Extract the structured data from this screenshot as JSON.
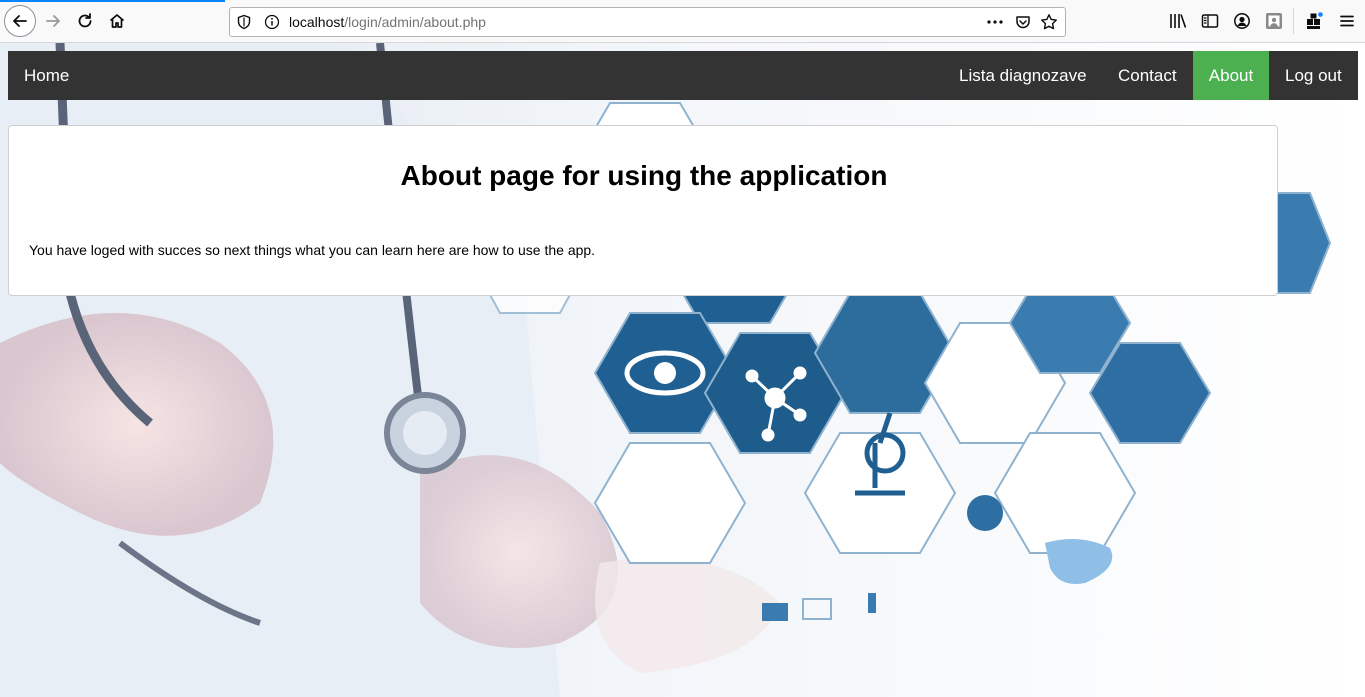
{
  "browser": {
    "url_host": "localhost",
    "url_path": "/login/admin/about.php",
    "icons": [
      "back-icon",
      "forward-icon",
      "reload-icon",
      "home-icon",
      "shield-icon",
      "info-icon",
      "page-actions-icon",
      "pocket-icon",
      "bookmark-star-icon",
      "library-icon",
      "sidebar-icon",
      "account-icon",
      "screenshot-icon",
      "extension-icon",
      "menu-icon"
    ],
    "accent_color": "#0a84ff"
  },
  "nav": {
    "home": "Home",
    "lista": "Lista diagnozave",
    "contact": "Contact",
    "about": "About",
    "logout": "Log out",
    "bar_color": "#333333",
    "active_color": "#4caf50"
  },
  "main": {
    "title": "About page for using the application",
    "text": "You have loged with succes so next things what you can learn here are how to use the app."
  }
}
